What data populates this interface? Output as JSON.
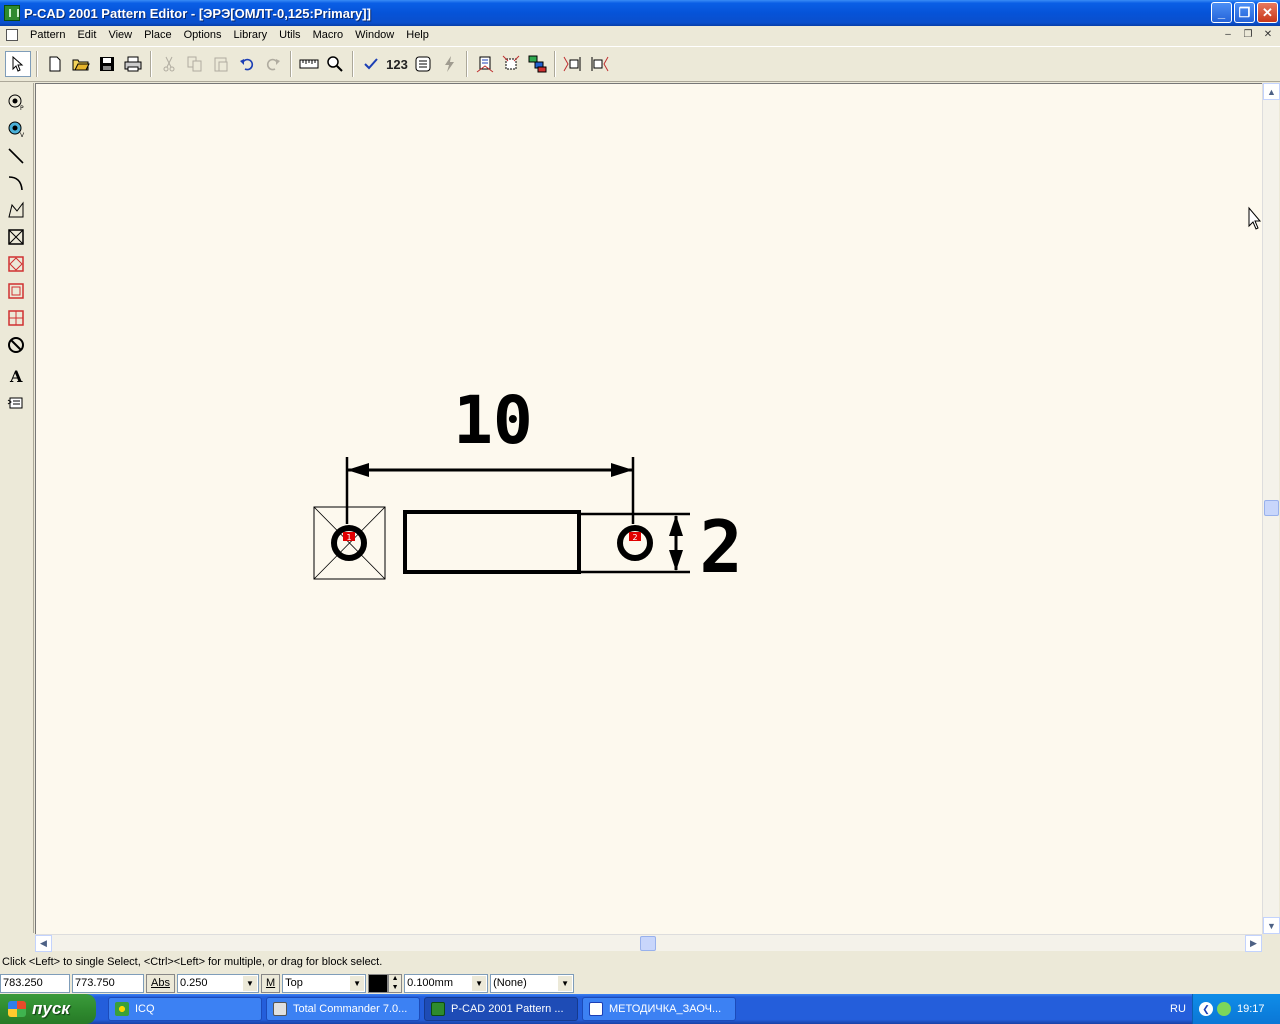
{
  "window": {
    "title": "P-CAD 2001 Pattern Editor - [ЭРЭ[ОМЛТ-0,125:Primary]]",
    "minimize": "_",
    "restore": "❐",
    "close": "✕"
  },
  "menu": {
    "items": [
      "Pattern",
      "Edit",
      "View",
      "Place",
      "Options",
      "Library",
      "Utils",
      "Macro",
      "Window",
      "Help"
    ],
    "mdi_minimize": "–",
    "mdi_restore": "❐",
    "mdi_close": "✕"
  },
  "toolbar": {
    "renumber_label": "123"
  },
  "drawing": {
    "dimension_horizontal": "10",
    "dimension_vertical": "2",
    "pad1_label": "1",
    "pad2_label": "2"
  },
  "status": {
    "hint": "Click <Left> to single Select, <Ctrl><Left> for multiple, or drag for block select.",
    "x_coord": "783.250",
    "y_coord": "773.750",
    "abs_label": "Abs",
    "grid": "0.250",
    "m_label": "M",
    "layer": "Top",
    "line_width": "0.100mm",
    "net": "(None)"
  },
  "taskbar": {
    "start_label": "пуск",
    "tasks": [
      {
        "label": "ICQ"
      },
      {
        "label": "Total Commander 7.0..."
      },
      {
        "label": "P-CAD 2001 Pattern ..."
      },
      {
        "label": "МЕТОДИЧКА_ЗАОЧ..."
      }
    ],
    "language": "RU",
    "clock": "19:17"
  },
  "colors": {
    "canvas_bg": "#fdf9ee",
    "pad_number_bg": "#e00000",
    "titlebar": "#0653d8",
    "taskbar": "#245edb",
    "start": "#2f8b2f"
  }
}
